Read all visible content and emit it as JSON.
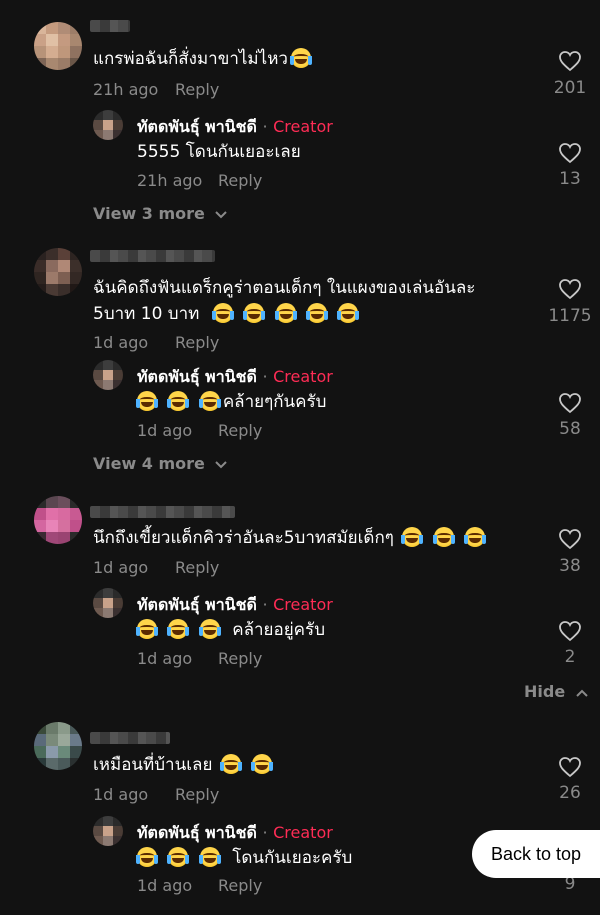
{
  "threads": [
    {
      "comment": {
        "text": "แกรพ่อฉันก็สั่งมาขาไม่ไหว",
        "emoji_count": 1,
        "time": "21h ago",
        "reply_label": "Reply",
        "likes": "201"
      },
      "reply": {
        "author": "ทัตดพันธุ์ พานิชดี",
        "dot": "·",
        "badge": "Creator",
        "text": "5555 โดนกันเยอะเลย",
        "emoji_before": 0,
        "time": "21h ago",
        "reply_label": "Reply",
        "likes": "13"
      },
      "more": "View 3 more"
    },
    {
      "comment": {
        "line1": "ฉันคิดถึงฟันแดร็กคูร่าตอนเด็กๆ ในแผงของเล่นอันละ",
        "line2": "5บาท 10 บาท",
        "emoji_count": 5,
        "time": "1d ago",
        "reply_label": "Reply",
        "likes": "1175"
      },
      "reply": {
        "author": "ทัตดพันธุ์ พานิชดี",
        "dot": "·",
        "badge": "Creator",
        "text": "คล้ายๆกันครับ",
        "emoji_before": 3,
        "time": "1d ago",
        "reply_label": "Reply",
        "likes": "58"
      },
      "more": "View 4 more"
    },
    {
      "comment": {
        "text": "นึกถึงเขี้ยวแด็กคิวร่าอันละ5บาทสมัยเด็กๆ",
        "emoji_count": 3,
        "time": "1d ago",
        "reply_label": "Reply",
        "likes": "38"
      },
      "reply": {
        "author": "ทัตดพันธุ์ พานิชดี",
        "dot": "·",
        "badge": "Creator",
        "text": "คล้ายอยู่ครับ",
        "emoji_before": 3,
        "time": "1d ago",
        "reply_label": "Reply",
        "likes": "2"
      },
      "hide": "Hide"
    },
    {
      "comment": {
        "text": "เหมือนที่บ้านเลย",
        "emoji_count": 2,
        "time": "1d ago",
        "reply_label": "Reply",
        "likes": "26"
      },
      "reply": {
        "author": "ทัตดพันธุ์ พานิชดี",
        "dot": "·",
        "badge": "Creator",
        "text": "โดนกันเยอะครับ",
        "emoji_before": 3,
        "time": "1d ago",
        "reply_label": "Reply",
        "likes": "9"
      }
    }
  ],
  "back_to_top": "Back to top",
  "icons": {
    "like": "heart-outline-icon",
    "expand": "chevron-down-icon",
    "collapse": "chevron-up-icon",
    "emoji": "laughing-tears-emoji"
  },
  "colors": {
    "background": "#121212",
    "creator_badge": "#fe2c55",
    "muted": "#8a8a8a"
  }
}
